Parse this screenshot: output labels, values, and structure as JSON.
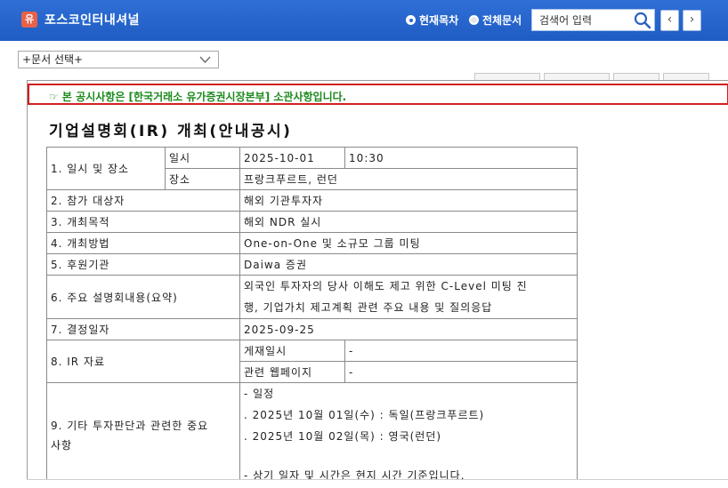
{
  "header": {
    "logo_text": "유",
    "company": "포스코인터내셔널",
    "radio_current": "현재목차",
    "radio_all": "전체문서",
    "search_placeholder": "검색어 입력",
    "prev_glyph": "‹",
    "next_glyph": "›"
  },
  "doc_select": {
    "value": "+문서 선택+"
  },
  "notice": {
    "text": "☞ 본 공시사항은 [한국거래소 유가증권시장본부] 소관사항입니다."
  },
  "title": "기업설명회(IR) 개최(안내공시)",
  "table": {
    "r1_label": "1. 일시 및 장소",
    "r1_sub_date": "일시",
    "r1_date": "2025-10-01",
    "r1_time": "10:30",
    "r1_sub_place": "장소",
    "r1_place": "프랑크푸르트, 런던",
    "r2_label": "2. 참가 대상자",
    "r2_value": "해외 기관투자자",
    "r3_label": "3. 개최목적",
    "r3_value": "해외 NDR 실시",
    "r4_label": "4. 개최방법",
    "r4_value": "One-on-One 및 소규모 그룹 미팅",
    "r5_label": "5. 후원기관",
    "r5_value": "Daiwa 증권",
    "r6_label": "6. 주요 설명회내용(요약)",
    "r6_line1": "외국인 투자자의 당사 이해도 제고 위한 C-Level 미팅 진",
    "r6_line2": "행, 기업가치 제고계획 관련 주요 내용 및 질의응답",
    "r7_label": "7. 결정일자",
    "r7_value": "2025-09-25",
    "r8_label": "8. IR 자료",
    "r8_sub1": "게재일시",
    "r8_val1": "-",
    "r8_sub2": "관련 웹페이지",
    "r8_val2": "-",
    "r9_label_line1": "9. 기타 투자판단과 관련한 중요",
    "r9_label_line2": "사항",
    "r9_line1": "- 일정",
    "r9_line2": ". 2025년 10월 01일(수) : 독일(프랑크푸르트)",
    "r9_line3": ". 2025년 10월 02일(목) : 영국(런던)",
    "r9_line4": "",
    "r9_line5": "- 상기 일자 및 시간은 현지 시간 기준입니다."
  }
}
